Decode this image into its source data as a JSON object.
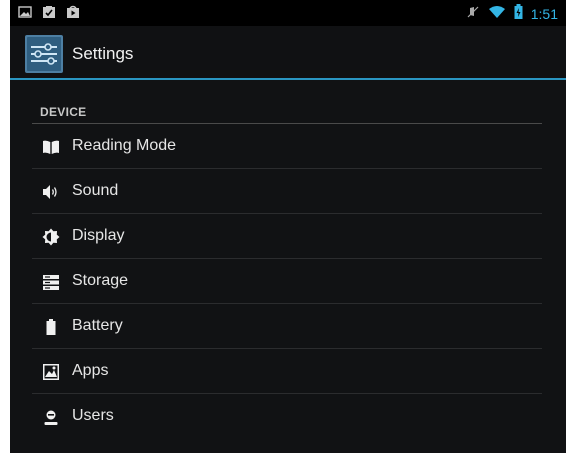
{
  "status_bar": {
    "left_icons": [
      "picture-notification-icon",
      "checklist-notification-icon",
      "play-store-notification-icon"
    ],
    "right_icons": [
      "mute-icon",
      "wifi-icon",
      "battery-charging-icon"
    ],
    "time": "1:51",
    "accent_color": "#33b5e5"
  },
  "action_bar": {
    "title": "Settings",
    "icon": "settings-sliders-icon",
    "divider_color": "#2a96c2"
  },
  "sections": [
    {
      "header": "DEVICE",
      "items": [
        {
          "label": "Reading Mode",
          "icon": "book-icon"
        },
        {
          "label": "Sound",
          "icon": "speaker-icon"
        },
        {
          "label": "Display",
          "icon": "brightness-icon"
        },
        {
          "label": "Storage",
          "icon": "storage-icon"
        },
        {
          "label": "Battery",
          "icon": "battery-icon"
        },
        {
          "label": "Apps",
          "icon": "apps-icon"
        },
        {
          "label": "Users",
          "icon": "user-icon"
        }
      ]
    }
  ]
}
